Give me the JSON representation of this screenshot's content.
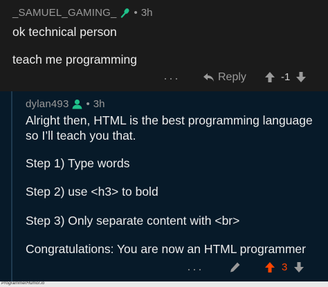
{
  "comment1": {
    "username": "_SAMUEL_GAMING_",
    "badge_icon": "microphone-icon",
    "time": "3h",
    "line1": "ok technical person",
    "line2": "teach me programming",
    "more_label": "···",
    "reply_label": "Reply",
    "score": "-1"
  },
  "comment2": {
    "username": "dylan493",
    "badge_icon": "user-icon",
    "time": "3h",
    "paragraph1": "Alright then, HTML is the best programming language so I’ll teach you that.",
    "step1": "Step 1) Type words",
    "step2": "Step 2) use <h3> to bold",
    "step3": "Step 3) Only separate content with <br>",
    "conclusion": "Congratulations: You are now an HTML programmer",
    "more_label": "···",
    "score": "3"
  },
  "footer": {
    "watermark": "ProgrammerHumor.io"
  },
  "colors": {
    "badge_green": "#1fc18a",
    "upvote_orange": "#ff4500",
    "comment1_bg": "#1b1b1b",
    "comment2_bg": "#071a29"
  }
}
